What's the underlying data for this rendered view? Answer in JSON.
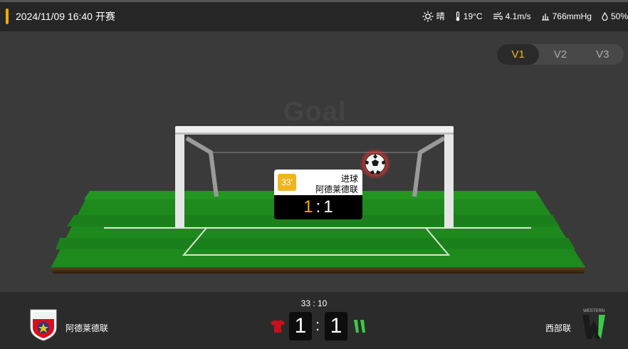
{
  "header": {
    "kickoff": "2024/11/09 16:40 开赛"
  },
  "weather": {
    "condition": "晴",
    "temperature": "19°C",
    "wind": "4.1m/s",
    "pressure": "766mmHg",
    "humidity": "50%"
  },
  "view_tabs": [
    "V1",
    "V2",
    "V3"
  ],
  "active_tab": "V1",
  "animation": {
    "event_word": "Goal",
    "popup": {
      "minute": "33'",
      "event": "进球",
      "team": "阿德莱德联",
      "score_home": "1",
      "score_away": "1"
    }
  },
  "match": {
    "clock": "33 : 10",
    "home": {
      "name": "阿德莱德联",
      "score": "1",
      "kit_color": "#c8101e"
    },
    "away": {
      "name": "西部联",
      "score": "1",
      "kit_color": "#3cc84a"
    }
  },
  "colors": {
    "accent": "#f5a800",
    "pitch": "#1e8a1e"
  }
}
